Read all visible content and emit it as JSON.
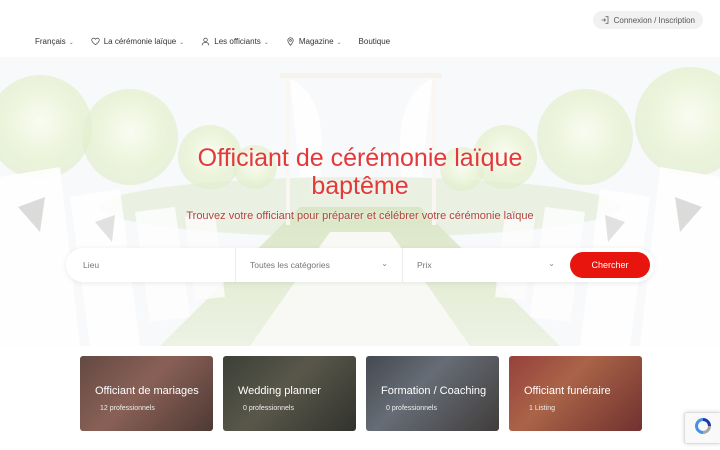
{
  "header": {
    "login": {
      "label": "Connexion / Inscription",
      "icon": "login-icon"
    },
    "nav": [
      {
        "label": "Français",
        "icon": "",
        "dropdown": true
      },
      {
        "label": "La cérémonie laïque",
        "icon": "heart-icon",
        "dropdown": true
      },
      {
        "label": "Les officiants",
        "icon": "user-icon",
        "dropdown": true
      },
      {
        "label": "Magazine",
        "icon": "map-pin-icon",
        "dropdown": true
      },
      {
        "label": "Boutique",
        "icon": "",
        "dropdown": false
      }
    ]
  },
  "hero": {
    "title_line1": "Officiant de cérémonie laïque",
    "title_line2": "baptême",
    "subtitle": "Trouvez votre officiant pour préparer et célébrer votre cérémonie laïque"
  },
  "search": {
    "location_placeholder": "Lieu",
    "category_value": "Toutes les catégories",
    "price_value": "Prix",
    "submit_label": "Chercher"
  },
  "categories": [
    {
      "title": "Officiant de mariages",
      "count": "12 professionnels"
    },
    {
      "title": "Wedding planner",
      "count": "0 professionnels"
    },
    {
      "title": "Formation / Coaching",
      "count": "0 professionnels"
    },
    {
      "title": "Officiant funéraire",
      "count": "1 Listing"
    }
  ],
  "colors": {
    "accent": "#e8150e",
    "hero_title": "#e23a3a"
  }
}
